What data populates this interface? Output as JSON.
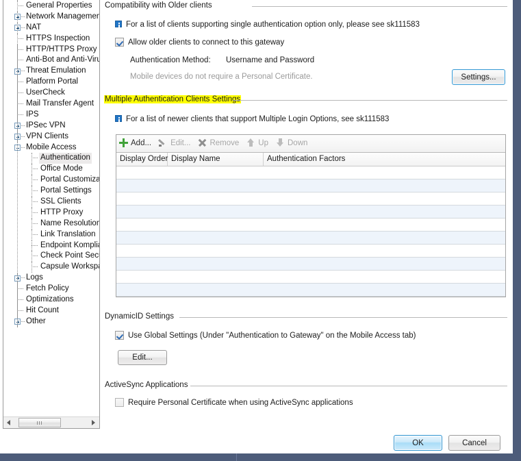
{
  "sidebar": {
    "items": [
      {
        "label": "General Properties",
        "indent": 0,
        "toggle": "none"
      },
      {
        "label": "Network Management",
        "indent": 0,
        "toggle": "plus"
      },
      {
        "label": "NAT",
        "indent": 0,
        "toggle": "plus"
      },
      {
        "label": "HTTPS Inspection",
        "indent": 0,
        "toggle": "none"
      },
      {
        "label": "HTTP/HTTPS Proxy",
        "indent": 0,
        "toggle": "none"
      },
      {
        "label": "Anti-Bot and Anti-Virus",
        "indent": 0,
        "toggle": "none"
      },
      {
        "label": "Threat Emulation",
        "indent": 0,
        "toggle": "plus"
      },
      {
        "label": "Platform Portal",
        "indent": 0,
        "toggle": "none"
      },
      {
        "label": "UserCheck",
        "indent": 0,
        "toggle": "none"
      },
      {
        "label": "Mail Transfer Agent",
        "indent": 0,
        "toggle": "none"
      },
      {
        "label": "IPS",
        "indent": 0,
        "toggle": "none"
      },
      {
        "label": "IPSec VPN",
        "indent": 0,
        "toggle": "plus"
      },
      {
        "label": "VPN Clients",
        "indent": 0,
        "toggle": "plus"
      },
      {
        "label": "Mobile Access",
        "indent": 0,
        "toggle": "minus"
      },
      {
        "label": "Authentication",
        "indent": 1,
        "toggle": "none",
        "selected": true
      },
      {
        "label": "Office Mode",
        "indent": 1,
        "toggle": "none"
      },
      {
        "label": "Portal Customizatio",
        "indent": 1,
        "toggle": "none"
      },
      {
        "label": "Portal Settings",
        "indent": 1,
        "toggle": "none"
      },
      {
        "label": "SSL Clients",
        "indent": 1,
        "toggle": "none"
      },
      {
        "label": "HTTP Proxy",
        "indent": 1,
        "toggle": "none"
      },
      {
        "label": "Name Resolution",
        "indent": 1,
        "toggle": "none"
      },
      {
        "label": "Link Translation",
        "indent": 1,
        "toggle": "none"
      },
      {
        "label": "Endpoint Komplian",
        "indent": 1,
        "toggle": "none"
      },
      {
        "label": "Check Point Secur",
        "indent": 1,
        "toggle": "none"
      },
      {
        "label": "Capsule Workspac",
        "indent": 1,
        "toggle": "none"
      },
      {
        "label": "Logs",
        "indent": 0,
        "toggle": "plus"
      },
      {
        "label": "Fetch Policy",
        "indent": 0,
        "toggle": "none"
      },
      {
        "label": "Optimizations",
        "indent": 0,
        "toggle": "none"
      },
      {
        "label": "Hit Count",
        "indent": 0,
        "toggle": "none"
      },
      {
        "label": "Other",
        "indent": 0,
        "toggle": "plus"
      }
    ],
    "hscroll": {
      "left_arrow": "scroll-left",
      "right_arrow": "scroll-right"
    }
  },
  "compatibility": {
    "title": "Compatibility with Older clients",
    "info_text": "For a list of clients supporting single authentication option only, please see sk111583",
    "allow_older_label": "Allow older clients to connect to this gateway",
    "allow_older_checked": true,
    "auth_method_label": "Authentication Method:",
    "auth_method_value": "Username and Password",
    "mobile_note": "Mobile devices do not require a Personal Certificate.",
    "settings_button": "Settings..."
  },
  "multiple_auth": {
    "title": "Multiple Authentication Clients Settings",
    "title_highlighted": true,
    "highlight_color": "#ffff00",
    "info_text": "For a list of newer clients that support Multiple Login Options, see sk111583",
    "toolbar": [
      {
        "label": "Add...",
        "icon": "plus-icon",
        "enabled": true
      },
      {
        "label": "Edit...",
        "icon": "pencil-icon",
        "enabled": false
      },
      {
        "label": "Remove",
        "icon": "x-icon",
        "enabled": false
      },
      {
        "label": "Up",
        "icon": "arrow-up-icon",
        "enabled": false
      },
      {
        "label": "Down",
        "icon": "arrow-down-icon",
        "enabled": false
      }
    ],
    "columns": [
      "Display Order",
      "Display Name",
      "Authentication Factors"
    ],
    "rows": [],
    "empty_row_count": 10
  },
  "dynamicid": {
    "title": "DynamicID Settings",
    "use_global_label": "Use Global Settings (Under \"Authentication to Gateway\" on the Mobile Access tab)",
    "use_global_checked": true,
    "edit_button": "Edit..."
  },
  "activesync": {
    "title": "ActiveSync Applications",
    "require_cert_label": "Require Personal Certificate when using ActiveSync applications",
    "require_cert_checked": false
  },
  "footer": {
    "ok_label": "OK",
    "cancel_label": "Cancel"
  },
  "colors": {
    "accent_blue": "#2175c6",
    "highlight_yellow": "#ffff00",
    "add_green": "#41a23a",
    "window_band": "#4d5c7a",
    "row_alt": "#eef4fb"
  }
}
